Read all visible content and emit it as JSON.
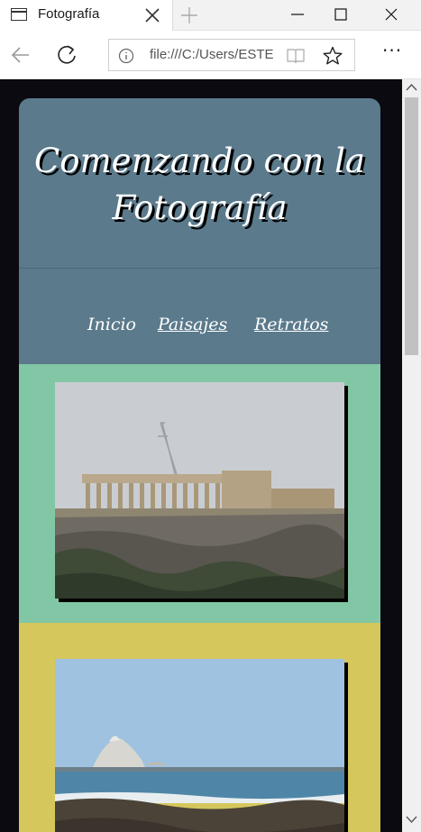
{
  "browser": {
    "tab_title": "Fotografía",
    "url": "file:///C:/Users/ESTE",
    "more_label": "···"
  },
  "page": {
    "site_title_line1": "Comenzando con la",
    "site_title_line2": "Fotografía",
    "menu": {
      "inicio": "Inicio",
      "paisajes": "Paisajes",
      "retratos": "Retratos"
    }
  },
  "colors": {
    "header": "#5b7a8c",
    "section_green": "#82c7a5",
    "section_yellow": "#d5c75c",
    "page_background": "#0a0a10"
  }
}
